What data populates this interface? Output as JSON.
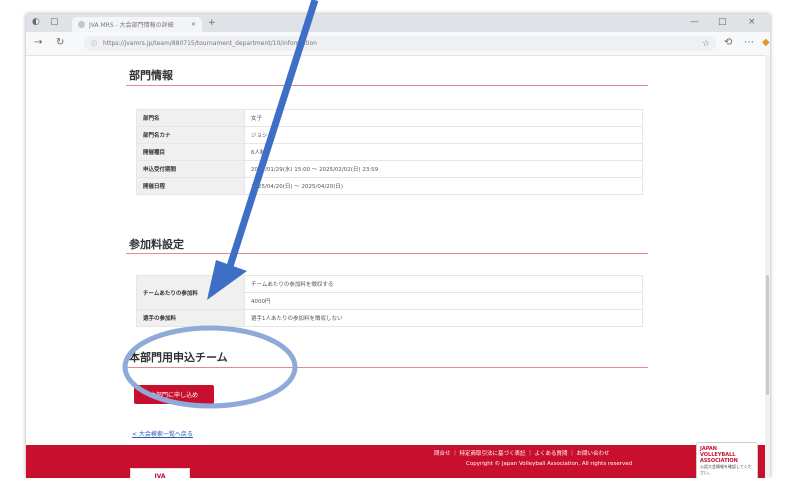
{
  "browser": {
    "tab_title": "JVA MRS - 大会部門情報の詳細",
    "tab_close": "×",
    "new_tab": "+",
    "url": "https://jvamrs.jp/team/880715/tournament_department/10/information",
    "window_controls": [
      "—",
      "□",
      "×"
    ]
  },
  "department_section": {
    "title": "部門情報",
    "rows": [
      {
        "label": "部門名",
        "value": "女子"
      },
      {
        "label": "部門名カナ",
        "value": "ジョシ"
      },
      {
        "label": "開催種目",
        "value": "6人制"
      },
      {
        "label": "申込受付期間",
        "value": "2025/01/29(水) 15:00 ～ 2025/02/02(日) 23:59"
      },
      {
        "label": "開催日程",
        "value": "2025/04/20(日) ～ 2025/04/20(日)"
      }
    ]
  },
  "fee_section": {
    "title": "参加料設定",
    "team_fee_label": "チームあたりの参加料",
    "team_fee_lines": [
      "チームあたりの参加料を徴収する",
      "4000円"
    ],
    "player_fee_label": "選手の参加料",
    "player_fee_value": "選手1人あたりの参加料を徴収しない"
  },
  "team_section": {
    "title": "本部門用申込チーム",
    "apply_button": "本部門に申し込め",
    "back_link": "< 大会検索一覧へ戻る"
  },
  "footer": {
    "links": "問合せ ｜ 特定商取引法に基づく表記 ｜ よくある質問 ｜ お問い合わせ",
    "copyright": "Copyright © Japan Volleyball Association, All rights reserved",
    "logo_text": "JVA",
    "badge_title": "JAPAN VOLLEYBALL ASSOCIATION",
    "badge_text": "公認大会情報を確認してください。"
  },
  "colors": {
    "accent_red": "#c8102e",
    "annotation_arrow": "#3e6fc6",
    "annotation_circle": "#8fa9d8"
  }
}
